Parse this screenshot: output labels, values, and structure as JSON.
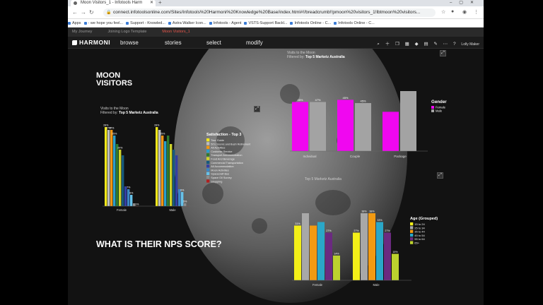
{
  "browser": {
    "tab_title": "Moon Visitors_1 - Infotools Harm",
    "url": "connect.infotoolsonline.com/Sites/Infotools%20Harmoni%20Knowledge%20Base/index.html#!/breadcrumb!!pmoon%20visitors_1!lbtmoon%20visitors...",
    "bookmarks": [
      "Apps",
      "- we hope you feel...",
      "Support - Knowled...",
      "Astra Walker Icon...",
      "Infotools - Agent",
      "VSTS-Support Backl...",
      "Infotools Online - C...",
      "Infotools Online - C..."
    ]
  },
  "breadcrumbs": [
    "My Journey",
    "Joining Logo Template",
    "Moon Visitors_1"
  ],
  "app": {
    "logo": "HARMONI",
    "menu": [
      "browse",
      "stories",
      "select",
      "modify"
    ],
    "user": "Lolly Maker"
  },
  "slide": {
    "title_line1": "MOON",
    "title_line2": "VISITORS",
    "question": "WHAT IS THEIR NPS SCORE?"
  },
  "colors": {
    "magenta": "#f007f0",
    "grey": "#a3a3a3",
    "age": [
      "#f3ef18",
      "#a8a8a8",
      "#f29a12",
      "#2aa7c8",
      "#6b2a80",
      "#bcd12e"
    ],
    "sat": [
      "#f1e71c",
      "#bdbdbd",
      "#f19612",
      "#2b9fcc",
      "#2f7a2e",
      "#cfd42a",
      "#175a7d",
      "#333fa3",
      "#3a86c6",
      "#66c2ea",
      "#8d8d8d",
      "#b02020"
    ]
  },
  "chart_data": [
    {
      "type": "bar",
      "id": "satisfaction",
      "title": "Visits to the Moon",
      "subtitle_prefix": "Filtered by:",
      "subtitle_filter": "Top 5 Marketz Australia",
      "categories": [
        "Female",
        "Male"
      ],
      "legend_title": "Satisfaction - Top 3",
      "series": [
        {
          "name": "Tour Guide",
          "values": [
            28,
            28
          ]
        },
        {
          "name": "50's Scenic and Bush Retirement",
          "values": [
            27,
            27
          ]
        },
        {
          "name": "All Activities",
          "values": [
            27,
            25
          ]
        },
        {
          "name": "Customer Service",
          "values": [
            25,
            23
          ]
        },
        {
          "name": "Transport Accommodation",
          "values": [
            22,
            25
          ]
        },
        {
          "name": "Food And Beverage",
          "values": [
            20,
            22
          ]
        },
        {
          "name": "Commercial Transportation",
          "values": [
            18,
            20
          ]
        },
        {
          "name": "All Accommodation",
          "values": [
            7,
            18
          ]
        },
        {
          "name": "Moon Activities",
          "values": [
            6,
            6
          ]
        },
        {
          "name": "Spacecraft Bus",
          "values": [
            4,
            5
          ]
        },
        {
          "name": "Space Oil Survey",
          "values": [
            1,
            1
          ]
        },
        {
          "name": "Shopping",
          "values": [
            0,
            0
          ]
        }
      ],
      "data_labels": [
        [
          "28%",
          "27%",
          "27%",
          "25%",
          "",
          "20%",
          "",
          "",
          "7%",
          "6%",
          "",
          "1%"
        ],
        [
          "28%",
          "",
          "25%",
          "",
          "",
          "",
          "",
          "",
          "",
          "6%",
          "5%",
          ""
        ]
      ]
    },
    {
      "type": "bar",
      "id": "gender",
      "title": "Visits to the Moon",
      "subtitle_prefix": "Filtered by:",
      "subtitle_filter": "Top 5 Marketz Australia",
      "categories": [
        "Individual",
        "Couple",
        "Package"
      ],
      "legend_title": "Gender",
      "series": [
        {
          "name": "Female",
          "values": [
            45,
            47,
            36
          ]
        },
        {
          "name": "Male",
          "values": [
            45,
            44,
            55
          ]
        }
      ],
      "data_labels": [
        [
          "45%",
          "47%",
          "36%"
        ],
        [
          "45%",
          "45%",
          "55%"
        ]
      ]
    },
    {
      "type": "bar",
      "id": "age",
      "title": "Top 5 Marketz Australia",
      "categories": [
        "Female",
        "Male"
      ],
      "legend_title": "Age (Grouped)",
      "series": [
        {
          "name": "15 to 24",
          "values": [
            31,
            27
          ]
        },
        {
          "name": "25 to 34",
          "values": [
            38,
            38
          ]
        },
        {
          "name": "35 to 44",
          "values": [
            31,
            38
          ]
        },
        {
          "name": "45 to 54",
          "values": [
            33,
            33
          ]
        },
        {
          "name": "55 to 64",
          "values": [
            27,
            27
          ]
        },
        {
          "name": "65+",
          "values": [
            14,
            15
          ]
        }
      ],
      "data_labels": [
        [
          "31%",
          "",
          "",
          "",
          "27%",
          "14%"
        ],
        [
          "27%",
          "38%",
          "38%",
          "33%",
          "27%",
          "15%"
        ]
      ]
    }
  ]
}
